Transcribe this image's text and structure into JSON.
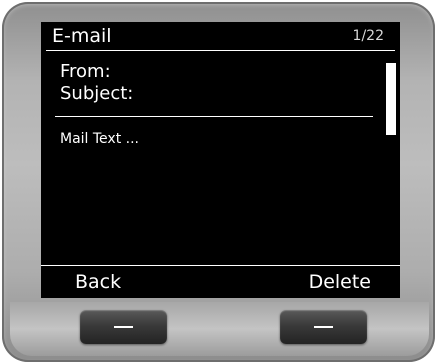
{
  "screen": {
    "title": "E-mail",
    "counter": "1/22",
    "from_label": "From:",
    "subject_label": "Subject:",
    "body_text": "Mail Text ..."
  },
  "softkeys": {
    "left_label": "Back",
    "right_label": "Delete"
  },
  "icons": {
    "scrollbar": "scrollbar-thumb",
    "hardware_keys": "dash-icon"
  },
  "colors": {
    "screen_background": "#000000",
    "screen_text": "#ffffff",
    "device_body": "#b3b3b3",
    "hardware_key": "#2e2e2e"
  }
}
